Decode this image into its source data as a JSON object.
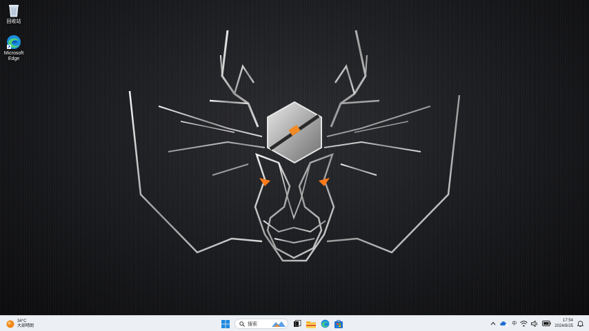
{
  "desktop": {
    "icons": [
      {
        "label": "回收站",
        "icon": "recycle-bin-icon"
      },
      {
        "label": "Microsoft Edge",
        "icon": "edge-icon"
      }
    ]
  },
  "taskbar": {
    "weather": {
      "temperature": "34°C",
      "condition": "大部晴朗",
      "icon": "sun-icon"
    },
    "search": {
      "placeholder": "搜索"
    },
    "pinned": [
      "windows-start-icon",
      "search-icon",
      "task-view-icon",
      "file-explorer-icon",
      "edge-icon",
      "microsoft-store-icon"
    ],
    "tray": {
      "ime": "中",
      "time": "17:54",
      "date": "2024/8/25"
    }
  },
  "colors": {
    "accent": "#0078d4",
    "eye_glow": "#ff7a1a",
    "taskbar": "#eceff3"
  }
}
